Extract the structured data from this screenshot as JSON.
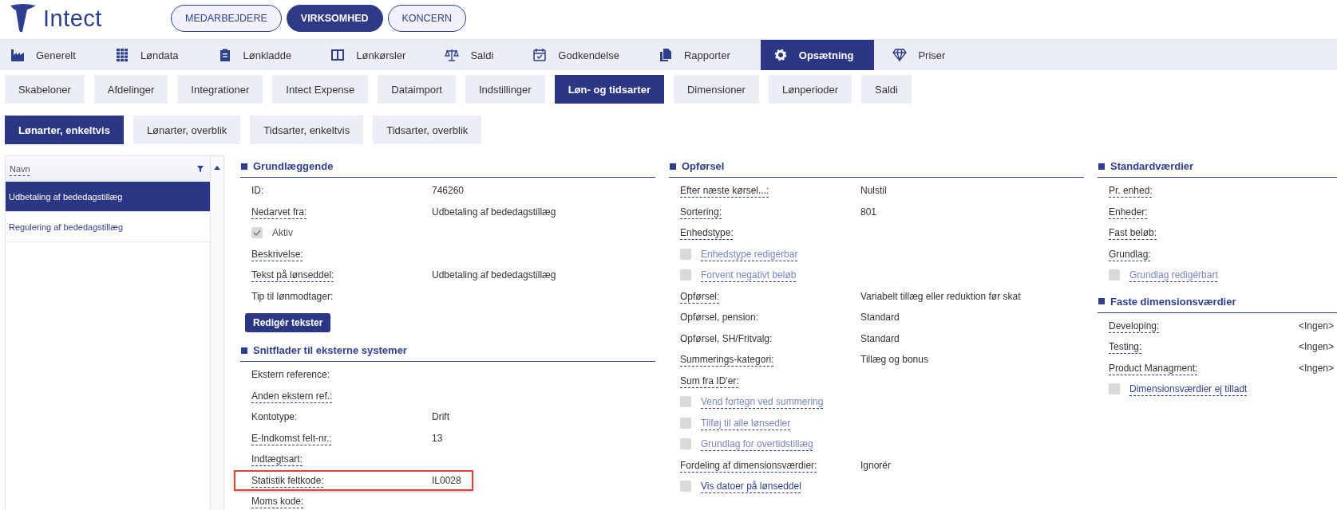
{
  "header": {
    "logo_text": "Intect",
    "scopes": [
      {
        "label": "MEDARBEJDERE",
        "selected": false
      },
      {
        "label": "VIRKSOMHED",
        "selected": true
      },
      {
        "label": "KONCERN",
        "selected": false
      }
    ]
  },
  "main_nav": [
    {
      "label": "Generelt",
      "selected": false
    },
    {
      "label": "Løndata",
      "selected": false
    },
    {
      "label": "Lønkladde",
      "selected": false
    },
    {
      "label": "Lønkørsler",
      "selected": false
    },
    {
      "label": "Saldi",
      "selected": false
    },
    {
      "label": "Godkendelse",
      "selected": false
    },
    {
      "label": "Rapporter",
      "selected": false
    },
    {
      "label": "Opsætning",
      "selected": true
    },
    {
      "label": "Priser",
      "selected": false
    }
  ],
  "sub_tabs": [
    {
      "label": "Skabeloner",
      "selected": false
    },
    {
      "label": "Afdelinger",
      "selected": false
    },
    {
      "label": "Integrationer",
      "selected": false
    },
    {
      "label": "Intect Expense",
      "selected": false
    },
    {
      "label": "Dataimport",
      "selected": false
    },
    {
      "label": "Indstillinger",
      "selected": false
    },
    {
      "label": "Løn- og tidsarter",
      "selected": true
    },
    {
      "label": "Dimensioner",
      "selected": false
    },
    {
      "label": "Lønperioder",
      "selected": false
    },
    {
      "label": "Saldi",
      "selected": false
    }
  ],
  "type_tabs": [
    {
      "label": "Lønarter, enkeltvis",
      "selected": true
    },
    {
      "label": "Lønarter, overblik",
      "selected": false
    },
    {
      "label": "Tidsarter, enkeltvis",
      "selected": false
    },
    {
      "label": "Tidsarter, overblik",
      "selected": false
    }
  ],
  "list": {
    "column": "Navn",
    "rows": [
      {
        "label": "Udbetaling af bededagstillæg",
        "selected": true
      },
      {
        "label": "Regulering af bededagstillæg",
        "selected": false
      }
    ]
  },
  "columns": [
    {
      "sections": [
        {
          "title": "Grundlæggende",
          "kind": "form",
          "rows": [
            {
              "kind": "field",
              "label": "ID:",
              "value": "746260",
              "underlined": false,
              "highlighted": false
            },
            {
              "kind": "field",
              "label": "Nedarvet fra:",
              "value": "Udbetaling af bededagstillæg",
              "underlined": true,
              "highlighted": false
            },
            {
              "kind": "checkbox",
              "label": "Aktiv",
              "checked": true,
              "disabled": false,
              "underlined": false
            },
            {
              "kind": "field",
              "label": "Beskrivelse:",
              "underlined": true,
              "highlighted": false
            },
            {
              "kind": "field",
              "label": "Tekst på lønseddel:",
              "value": "Udbetaling af bededagstillæg",
              "underlined": true,
              "highlighted": false
            },
            {
              "kind": "field",
              "label": "Tip til lønmodtager:",
              "underlined": false,
              "highlighted": false
            },
            {
              "kind": "button",
              "label": "Redigér tekster"
            }
          ]
        },
        {
          "title": "Snitflader til eksterne systemer",
          "kind": "form",
          "rows": [
            {
              "kind": "field",
              "label": "Ekstern reference:",
              "underlined": false,
              "highlighted": false
            },
            {
              "kind": "field",
              "label": "Anden ekstern ref.:",
              "underlined": true,
              "highlighted": false
            },
            {
              "kind": "field",
              "label": "Kontotype:",
              "value": "Drift",
              "underlined": false,
              "highlighted": false
            },
            {
              "kind": "field",
              "label": "E-Indkomst felt-nr.:",
              "value": "13",
              "underlined": true,
              "highlighted": false
            },
            {
              "kind": "field",
              "label": "Indtægtsart:",
              "underlined": true,
              "highlighted": false
            },
            {
              "kind": "field",
              "label": "Statistik feltkode:",
              "value": "IL0028",
              "underlined": true,
              "highlighted": true
            },
            {
              "kind": "field",
              "label": "Moms kode:",
              "underlined": true,
              "highlighted": false
            }
          ]
        }
      ]
    },
    {
      "sections": [
        {
          "title": "Opførsel",
          "kind": "form",
          "rows": [
            {
              "kind": "field",
              "label": "Efter næste kørsel...:",
              "value": "Nulstil",
              "underlined": true,
              "highlighted": false
            },
            {
              "kind": "field",
              "label": "Sortering:",
              "value": "801",
              "underlined": true,
              "highlighted": false
            },
            {
              "kind": "field",
              "label": "Enhedstype:",
              "underlined": true,
              "highlighted": false
            },
            {
              "kind": "checkbox",
              "label": "Enhedstype redigérbar",
              "checked": false,
              "disabled": true,
              "underlined": true
            },
            {
              "kind": "checkbox",
              "label": "Forvent negativt beløb",
              "checked": false,
              "disabled": true,
              "underlined": true
            },
            {
              "kind": "field",
              "label": "Opførsel:",
              "value": "Variabelt tillæg eller reduktion før skat",
              "underlined": true,
              "highlighted": false
            },
            {
              "kind": "field",
              "label": "Opførsel, pension:",
              "value": "Standard",
              "underlined": false,
              "highlighted": false
            },
            {
              "kind": "field",
              "label": "Opførsel, SH/Fritvalg:",
              "value": "Standard",
              "underlined": false,
              "highlighted": false
            },
            {
              "kind": "field",
              "label": "Summerings-kategori:",
              "value": "Tillæg og bonus",
              "underlined": true,
              "highlighted": false
            },
            {
              "kind": "field",
              "label": "Sum fra ID'er:",
              "underlined": true,
              "highlighted": false
            },
            {
              "kind": "checkbox",
              "label": "Vend fortegn ved summering",
              "checked": false,
              "disabled": true,
              "underlined": true
            },
            {
              "kind": "checkbox",
              "label": "Tilføj til alle lønsedler",
              "checked": false,
              "disabled": true,
              "underlined": true
            },
            {
              "kind": "checkbox",
              "label": "Grundlag for overtidstillæg",
              "checked": false,
              "disabled": true,
              "underlined": true
            },
            {
              "kind": "field",
              "label": "Fordeling af dimensionsværdier:",
              "value": "Ignorér",
              "underlined": true,
              "highlighted": false
            },
            {
              "kind": "checkbox",
              "label": "Vis datoer på lønseddel",
              "checked": false,
              "disabled": false,
              "underlined": true
            }
          ]
        }
      ]
    },
    {
      "sections": [
        {
          "title": "Standardværdier",
          "kind": "form",
          "rows": [
            {
              "kind": "field",
              "label": "Pr. enhed:",
              "underlined": true,
              "highlighted": false
            },
            {
              "kind": "field",
              "label": "Enheder:",
              "underlined": true,
              "highlighted": false
            },
            {
              "kind": "field",
              "label": "Fast beløb:",
              "underlined": true,
              "highlighted": false
            },
            {
              "kind": "field",
              "label": "Grundlag:",
              "underlined": true,
              "highlighted": false
            },
            {
              "kind": "checkbox",
              "label": "Grundlag redigérbart",
              "checked": false,
              "disabled": true,
              "underlined": true
            }
          ]
        },
        {
          "title": "Faste dimensionsværdier",
          "kind": "dimensions",
          "rows": [
            {
              "kind": "field",
              "label": "Developing:",
              "value": "<Ingen>",
              "underlined": true,
              "highlighted": false
            },
            {
              "kind": "field",
              "label": "Testing:",
              "value": "<Ingen>",
              "underlined": true,
              "highlighted": false
            },
            {
              "kind": "field",
              "label": "Product Managment:",
              "value": "<Ingen>",
              "underlined": true,
              "highlighted": false
            },
            {
              "kind": "checkbox",
              "label": "Dimensionsværdier ej tilladt",
              "checked": false,
              "disabled": false,
              "underlined": true
            }
          ]
        }
      ]
    }
  ]
}
